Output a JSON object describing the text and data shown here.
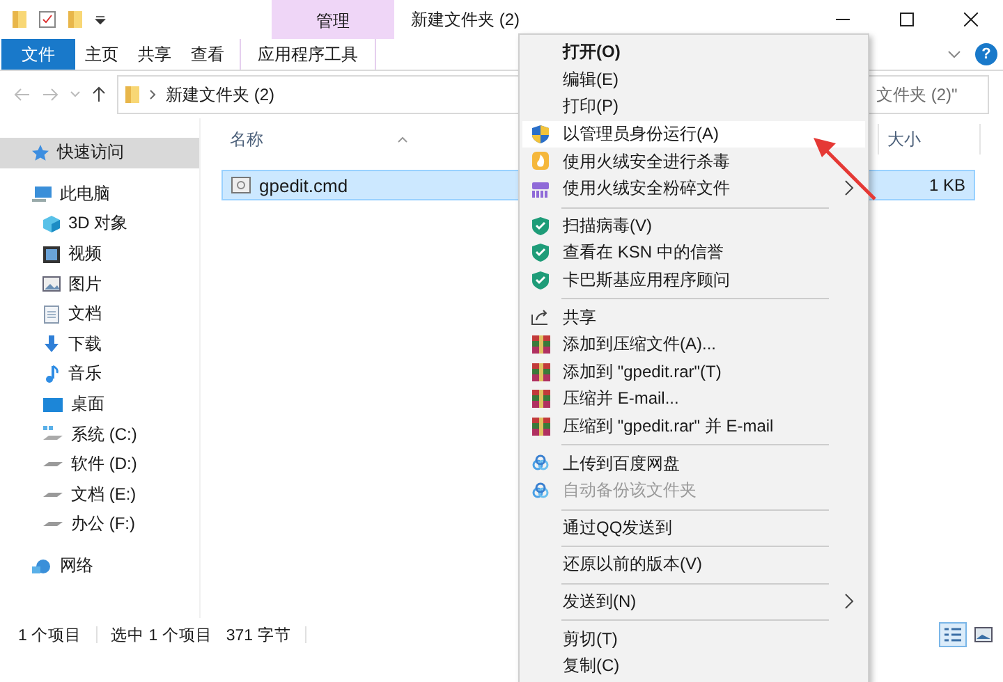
{
  "title_bar": {
    "context_label": "管理",
    "title": "新建文件夹 (2)"
  },
  "ribbon": {
    "tabs": [
      {
        "label": "文件",
        "kind": "file"
      },
      {
        "label": "主页",
        "kind": "normal"
      },
      {
        "label": "共享",
        "kind": "normal"
      },
      {
        "label": "查看",
        "kind": "normal"
      },
      {
        "label": "应用程序工具",
        "kind": "context"
      }
    ],
    "help": "?"
  },
  "address": {
    "path": "新建文件夹 (2)"
  },
  "search": {
    "placeholder": "文件夹 (2)\""
  },
  "sidebar": {
    "items": [
      {
        "label": "快速访问",
        "kind": "star",
        "selected": true
      },
      {
        "label": "此电脑",
        "kind": "pc",
        "selected": false,
        "children": [
          {
            "label": "3D 对象",
            "kind": "cube",
            "selected": false
          },
          {
            "label": "视频",
            "kind": "film",
            "selected": false
          },
          {
            "label": "图片",
            "kind": "picture",
            "selected": false
          },
          {
            "label": "文档",
            "kind": "document",
            "selected": false
          },
          {
            "label": "下载",
            "kind": "download",
            "selected": false
          },
          {
            "label": "音乐",
            "kind": "music",
            "selected": false
          },
          {
            "label": "桌面",
            "kind": "desktop",
            "selected": false
          },
          {
            "label": "系统 (C:)",
            "kind": "windrive",
            "selected": false
          },
          {
            "label": "软件 (D:)",
            "kind": "drive",
            "selected": false
          },
          {
            "label": "文档 (E:)",
            "kind": "drive",
            "selected": false
          },
          {
            "label": "办公 (F:)",
            "kind": "drive",
            "selected": false
          }
        ]
      },
      {
        "label": "网络",
        "kind": "network",
        "selected": false
      }
    ]
  },
  "file_list": {
    "columns": [
      {
        "label": "名称"
      },
      {
        "label": "大小"
      }
    ],
    "rows": [
      {
        "name": "gpedit.cmd",
        "size": "1 KB",
        "selected": true
      }
    ]
  },
  "context_menu": {
    "groups": [
      {
        "items": [
          {
            "label": "打开(O)",
            "kind": "plain",
            "default": true,
            "disabled": false,
            "submenu": false,
            "selected": false
          },
          {
            "label": "编辑(E)",
            "kind": "plain",
            "default": false,
            "disabled": false,
            "submenu": false,
            "selected": false
          },
          {
            "label": "打印(P)",
            "kind": "plain",
            "default": false,
            "disabled": false,
            "submenu": false,
            "selected": false
          },
          {
            "label": "以管理员身份运行(A)",
            "kind": "uac",
            "default": false,
            "disabled": false,
            "submenu": false,
            "selected": true
          },
          {
            "label": "使用火绒安全进行杀毒",
            "kind": "fire",
            "default": false,
            "disabled": false,
            "submenu": false,
            "selected": false
          },
          {
            "label": "使用火绒安全粉碎文件",
            "kind": "shredder",
            "default": false,
            "disabled": false,
            "submenu": true,
            "selected": false
          }
        ]
      },
      {
        "items": [
          {
            "label": "扫描病毒(V)",
            "kind": "kaspersky",
            "default": false,
            "disabled": false,
            "submenu": false,
            "selected": false
          },
          {
            "label": "查看在 KSN 中的信誉",
            "kind": "kaspersky",
            "default": false,
            "disabled": false,
            "submenu": false,
            "selected": false
          },
          {
            "label": "卡巴斯基应用程序顾问",
            "kind": "kaspersky",
            "default": false,
            "disabled": false,
            "submenu": false,
            "selected": false
          }
        ]
      },
      {
        "items": [
          {
            "label": "共享",
            "kind": "share",
            "default": false,
            "disabled": false,
            "submenu": false,
            "selected": false
          },
          {
            "label": "添加到压缩文件(A)...",
            "kind": "winrar",
            "default": false,
            "disabled": false,
            "submenu": false,
            "selected": false
          },
          {
            "label": "添加到 \"gpedit.rar\"(T)",
            "kind": "winrar",
            "default": false,
            "disabled": false,
            "submenu": false,
            "selected": false
          },
          {
            "label": "压缩并 E-mail...",
            "kind": "winrar",
            "default": false,
            "disabled": false,
            "submenu": false,
            "selected": false
          },
          {
            "label": "压缩到 \"gpedit.rar\" 并 E-mail",
            "kind": "winrar",
            "default": false,
            "disabled": false,
            "submenu": false,
            "selected": false
          }
        ]
      },
      {
        "items": [
          {
            "label": "上传到百度网盘",
            "kind": "baidu",
            "default": false,
            "disabled": false,
            "submenu": false,
            "selected": false
          },
          {
            "label": "自动备份该文件夹",
            "kind": "baidu",
            "default": false,
            "disabled": true,
            "submenu": false,
            "selected": false
          }
        ]
      },
      {
        "items": [
          {
            "label": "通过QQ发送到",
            "kind": "plain",
            "default": false,
            "disabled": false,
            "submenu": false,
            "selected": false
          }
        ]
      },
      {
        "items": [
          {
            "label": "还原以前的版本(V)",
            "kind": "plain",
            "default": false,
            "disabled": false,
            "submenu": false,
            "selected": false
          }
        ]
      },
      {
        "items": [
          {
            "label": "发送到(N)",
            "kind": "plain",
            "default": false,
            "disabled": false,
            "submenu": true,
            "selected": false
          }
        ]
      },
      {
        "items": [
          {
            "label": "剪切(T)",
            "kind": "plain",
            "default": false,
            "disabled": false,
            "submenu": false,
            "selected": false
          },
          {
            "label": "复制(C)",
            "kind": "plain",
            "default": false,
            "disabled": false,
            "submenu": false,
            "selected": false
          }
        ]
      }
    ]
  },
  "status_bar": {
    "item_count": "1 个项目",
    "selection": "选中 1 个项目",
    "size": "371 字节"
  },
  "view_buttons": [
    {
      "kind": "details",
      "selected": true
    },
    {
      "kind": "tiles",
      "selected": false
    }
  ]
}
